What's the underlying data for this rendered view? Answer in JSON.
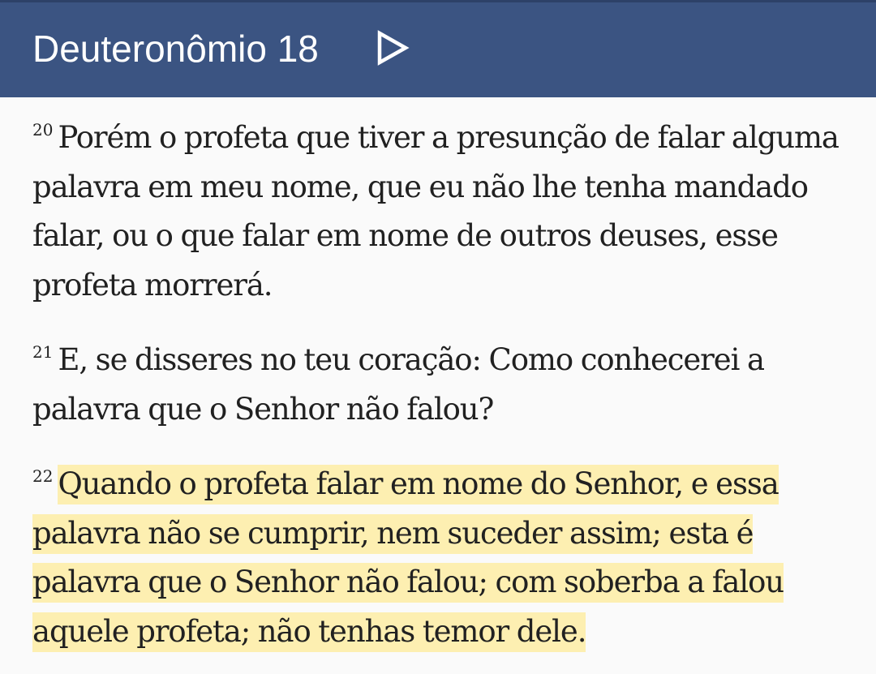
{
  "header": {
    "title": "Deuteronômio 18",
    "play_icon": "play-icon",
    "background_color": "#3b5482"
  },
  "verses": [
    {
      "number": "20",
      "text": "Porém o profeta que tiver a presunção de falar alguma palavra em meu nome, que eu não lhe tenha mandado falar, ou o que falar em nome de outros deuses, esse profeta morrerá.",
      "highlighted": false
    },
    {
      "number": "21",
      "text": "E, se disseres no teu coração: Como conhecerei a palavra que o Senhor não falou?",
      "highlighted": false
    },
    {
      "number": "22",
      "text": "Quando o profeta falar em nome do Senhor, e essa palavra não se cumprir, nem suceder assim; esta é palavra que o Senhor não falou; com soberba a falou aquele profeta; não tenhas temor dele.",
      "highlighted": true
    }
  ],
  "colors": {
    "highlight": "#fdefb1",
    "text": "#212121",
    "page_background": "#fafafa"
  }
}
